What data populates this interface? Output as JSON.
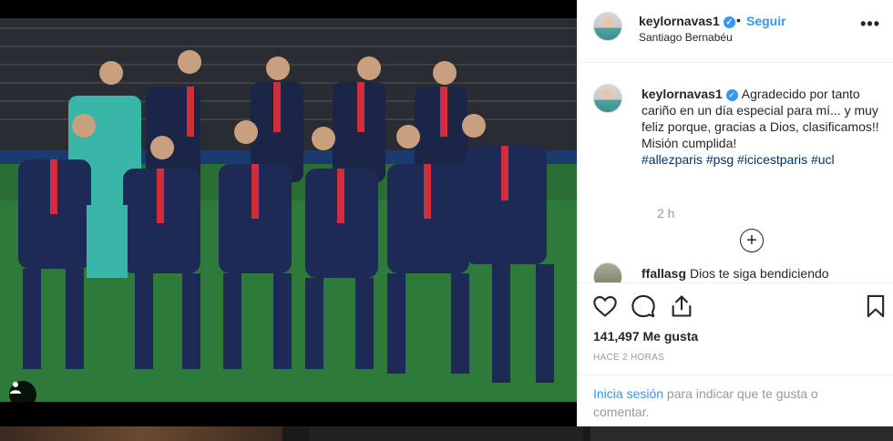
{
  "post": {
    "image_alt_icon": "person-icon",
    "author": {
      "username": "keylornavas1",
      "verified_icon": "verified-badge-icon",
      "follow_label": "Seguir",
      "separator": "•",
      "location": "Santiago Bernabéu"
    },
    "more_icon": "ellipsis-icon",
    "caption": {
      "username": "keylornavas1",
      "text": "Agradecido por tanto cariño en un día especial para mí... y muy feliz porque, gracias a Dios, clasificamos!! Misión cumplida!",
      "hashtags": "#allezparis #psg #icicestparis #ucl",
      "time": "2 h"
    },
    "load_more_icon": "plus-circle-icon",
    "comment": {
      "username": "ffallasg",
      "text": "Dios te siga bendiciendo"
    },
    "actions": {
      "like_icon": "heart-icon",
      "comment_icon": "comment-icon",
      "share_icon": "share-icon",
      "save_icon": "bookmark-icon"
    },
    "likes": "141,497 Me gusta",
    "posted_ago": "HACE 2 HORAS",
    "login_prompt": {
      "link": "Inicia sesión",
      "rest": " para indicar que te gusta o comentar."
    }
  }
}
